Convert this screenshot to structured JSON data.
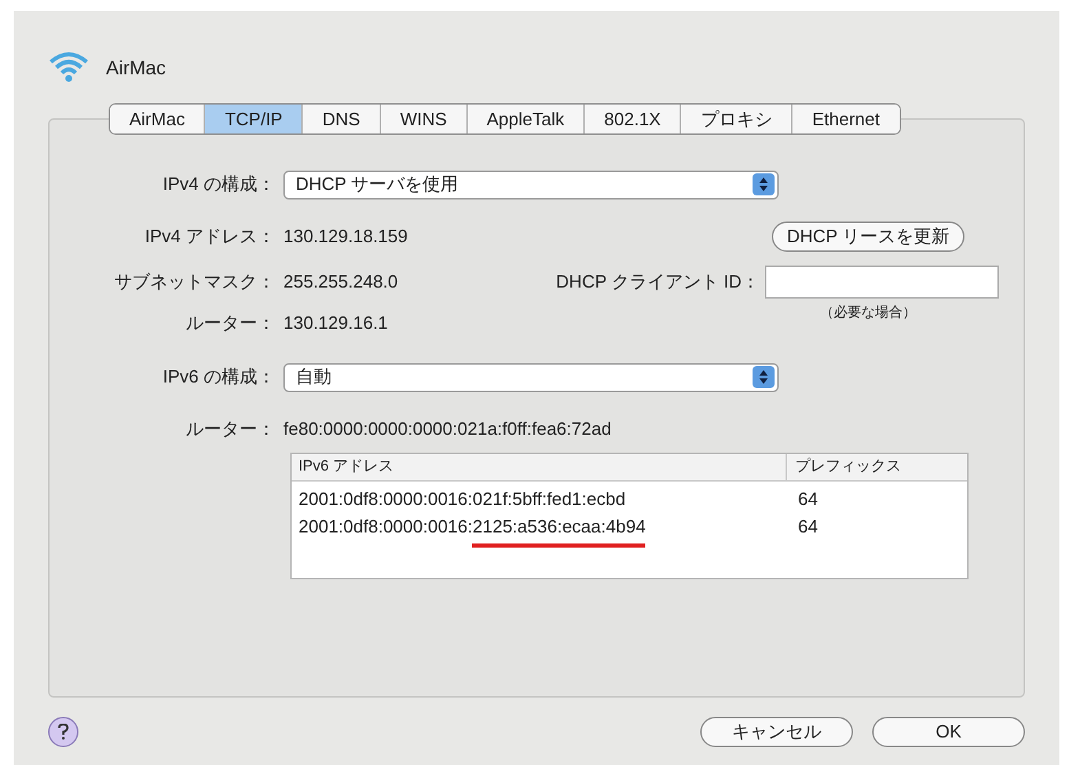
{
  "window": {
    "title": "AirMac"
  },
  "tabs": [
    {
      "label": "AirMac",
      "selected": false
    },
    {
      "label": "TCP/IP",
      "selected": true
    },
    {
      "label": "DNS",
      "selected": false
    },
    {
      "label": "WINS",
      "selected": false
    },
    {
      "label": "AppleTalk",
      "selected": false
    },
    {
      "label": "802.1X",
      "selected": false
    },
    {
      "label": "プロキシ",
      "selected": false
    },
    {
      "label": "Ethernet",
      "selected": false
    }
  ],
  "ipv4": {
    "config_label": "IPv4 の構成：",
    "config_value": "DHCP サーバを使用",
    "address_label": "IPv4 アドレス：",
    "address": "130.129.18.159",
    "renew_button": "DHCP リースを更新",
    "subnet_label": "サブネットマスク：",
    "subnet": "255.255.248.0",
    "client_id_label": "DHCP クライアント ID：",
    "client_id_hint": "（必要な場合）",
    "router_label": "ルーター：",
    "router": "130.129.16.1"
  },
  "ipv6": {
    "config_label": "IPv6 の構成：",
    "config_value": "自動",
    "router_label": "ルーター：",
    "router": "fe80:0000:0000:0000:021a:f0ff:fea6:72ad",
    "table": {
      "columns": [
        "IPv6 アドレス",
        "プレフィックス"
      ],
      "rows": [
        {
          "address": "2001:0df8:0000:0016:021f:5bff:fed1:ecbd",
          "prefix": "64",
          "underlined": false
        },
        {
          "address": "2001:0df8:0000:0016:2125:a536:ecaa:4b94",
          "prefix": "64",
          "underlined": true
        }
      ]
    }
  },
  "buttons": {
    "cancel": "キャンセル",
    "ok": "OK"
  }
}
